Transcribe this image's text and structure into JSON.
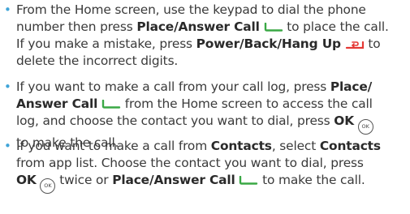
{
  "colors": {
    "bullet": "#3fa4d8",
    "call_icon": "#3aa845",
    "hang_icon": "#e53935"
  },
  "icons": {
    "call": "call-key-icon",
    "hang_up": "hang-up-key-icon",
    "ok": "ok-key-icon"
  },
  "ok_key_text": "OK",
  "bullets": [
    {
      "bullet_char": "•",
      "lines": [
        {
          "t1": "From the Home screen, use the keypad to dial the phone"
        },
        {
          "t1": "number then press ",
          "b1": "Place/Answer Call",
          "t2": " to place the call."
        },
        {
          "t1": "If you make a mistake, press ",
          "b1": "Power/Back/Hang Up",
          "t2": " to"
        },
        {
          "t1": "delete the incorrect digits."
        }
      ]
    },
    {
      "bullet_char": "•",
      "lines": [
        {
          "t1": "If you want to make a call from your call log, press ",
          "b1": "Place/"
        },
        {
          "b1": "Answer Call",
          "t1": " from the Home screen to access the call"
        },
        {
          "t1": "log, and choose the contact you want to dial, press ",
          "b1": "OK"
        },
        {
          "t1": "to make the call."
        }
      ]
    },
    {
      "bullet_char": "•",
      "lines": [
        {
          "t1": "If you want to make a call from ",
          "b1": "Contacts",
          "t2": ", select ",
          "b2": "Contacts"
        },
        {
          "t1": "from app list. Choose the contact you want to dial, press"
        },
        {
          "b1": "OK",
          "t1": " twice or ",
          "b2": "Place/Answer Call",
          "t2": " to make the call."
        }
      ]
    }
  ]
}
